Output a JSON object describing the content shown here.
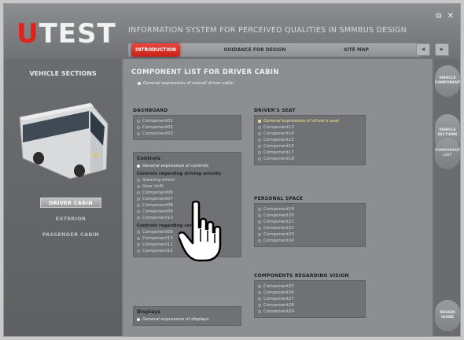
{
  "header": {
    "logo_mark": "U",
    "logo_text": "TEST",
    "app_title": "INFORMATION SYSTEM FOR PERCEIVED QUALITIES IN SMMBUS DESIGN",
    "window_controls": [
      "⧉",
      "✕"
    ],
    "tabs": [
      {
        "label": "INTRODUCTION",
        "active": true
      },
      {
        "label": "GUIDANCE FOR DESIGN",
        "active": false
      },
      {
        "label": "SITE MAP",
        "active": false
      }
    ],
    "buttons": [
      "◂",
      "▸"
    ]
  },
  "left": {
    "section_title": "VEHICLE SECTIONS",
    "nav": [
      {
        "label": "DRIVER CABIN",
        "active": true
      },
      {
        "label": "EXTERIOR",
        "active": false
      },
      {
        "label": "PASSENGER CABIN",
        "active": false
      }
    ]
  },
  "main": {
    "title": "COMPONENT LIST FOR DRIVER CABIN",
    "general": "General expression of overall driver cabin",
    "dashboard": {
      "title": "DASHBOARD",
      "items": [
        "Component01",
        "Component02",
        "Component03"
      ]
    },
    "controls": {
      "title": "Controls",
      "general": "General expression of controls",
      "driving_title": "Controls regarding driving activity",
      "driving_items": [
        "Steering wheel",
        "Gear shift",
        "Component06",
        "Component07",
        "Component08",
        "Component09",
        "Component10"
      ],
      "comfort_title": "Controls regarding comfort",
      "comfort_items": [
        "Component09",
        "Component10",
        "Component11",
        "Component12"
      ]
    },
    "displays": {
      "title": "Displays",
      "general": "General expression of displays"
    },
    "seat": {
      "title": "DRIVER'S SEAT",
      "general": "General expression of driver's seat",
      "items": [
        "Component13",
        "Component14",
        "Component15",
        "Component16",
        "Component17",
        "Component18"
      ]
    },
    "personal": {
      "title": "PERSONAL SPACE",
      "items": [
        "Component19",
        "Component20",
        "Component21",
        "Component22",
        "Component23",
        "Component24"
      ]
    },
    "vision": {
      "title": "COMPONENTS REGARDING VISION",
      "items": [
        "Component25",
        "Component26",
        "Component27",
        "Component28",
        "Component29"
      ]
    }
  },
  "rail": {
    "buttons": [
      "VEHICLE COMPONENT",
      "VEHICLE SECTIONS",
      "COMPONENT LIST",
      "DESIGN GUIDE"
    ]
  },
  "colors": {
    "accent": "#e0241b",
    "highlight": "#f6e88a"
  },
  "icons": [
    "bus-image",
    "hand-pointer-icon"
  ]
}
